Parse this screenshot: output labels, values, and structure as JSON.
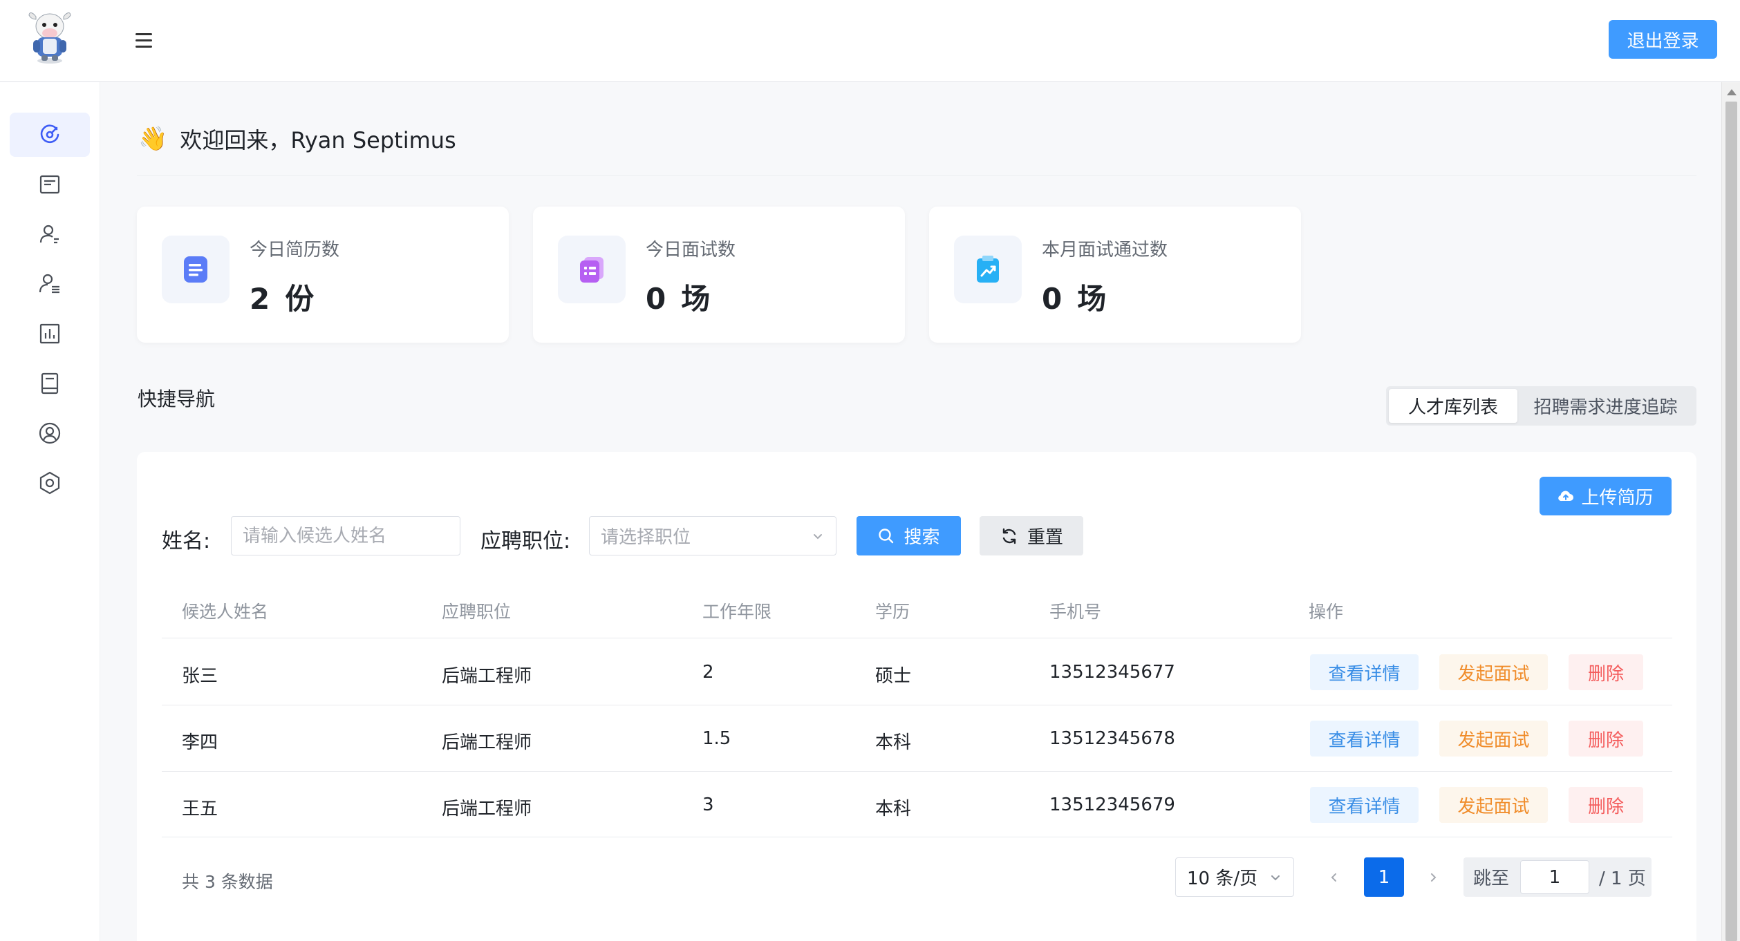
{
  "header": {
    "logout_label": "退出登录"
  },
  "sidebar": {
    "items": [
      {
        "icon": "dashboard-icon",
        "active": true
      },
      {
        "icon": "document-icon",
        "active": false
      },
      {
        "icon": "candidate-icon",
        "active": false
      },
      {
        "icon": "user-list-icon",
        "active": false
      },
      {
        "icon": "bar-chart-icon",
        "active": false
      },
      {
        "icon": "book-icon",
        "active": false
      },
      {
        "icon": "user-circle-icon",
        "active": false
      },
      {
        "icon": "settings-hexagon-icon",
        "active": false
      }
    ]
  },
  "welcome": {
    "emoji": "👋",
    "text": "欢迎回来，Ryan Septimus"
  },
  "stats": [
    {
      "label": "今日简历数",
      "value": "2",
      "unit": "份",
      "icon": "resume-icon",
      "color": "#5b7cf7"
    },
    {
      "label": "今日面试数",
      "value": "0",
      "unit": "场",
      "icon": "interview-icon",
      "color": "#b65ff2"
    },
    {
      "label": "本月面试通过数",
      "value": "0",
      "unit": "场",
      "icon": "trend-clipboard-icon",
      "color": "#27b0f5"
    }
  ],
  "quick_nav": {
    "title": "快捷导航",
    "tabs": [
      "人才库列表",
      "招聘需求进度追踪"
    ],
    "active_tab": 0
  },
  "filters": {
    "upload_label": "上传简历",
    "name_label": "姓名:",
    "name_placeholder": "请输入候选人姓名",
    "job_label": "应聘职位:",
    "job_placeholder": "请选择职位",
    "search_label": "搜索",
    "reset_label": "重置"
  },
  "table": {
    "columns": [
      "候选人姓名",
      "应聘职位",
      "工作年限",
      "学历",
      "手机号",
      "操作"
    ],
    "rows": [
      {
        "name": "张三",
        "job": "后端工程师",
        "years": "2",
        "degree": "硕士",
        "phone": "13512345677"
      },
      {
        "name": "李四",
        "job": "后端工程师",
        "years": "1.5",
        "degree": "本科",
        "phone": "13512345678"
      },
      {
        "name": "王五",
        "job": "后端工程师",
        "years": "3",
        "degree": "本科",
        "phone": "13512345679"
      }
    ],
    "actions": {
      "view": "查看详情",
      "invite": "发起面试",
      "delete": "删除"
    }
  },
  "pagination": {
    "total_text": "共 3 条数据",
    "page_size": "10 条/页",
    "current_page": "1",
    "jump_label": "跳至",
    "jump_value": "1",
    "total_pages": "/ 1 页"
  }
}
